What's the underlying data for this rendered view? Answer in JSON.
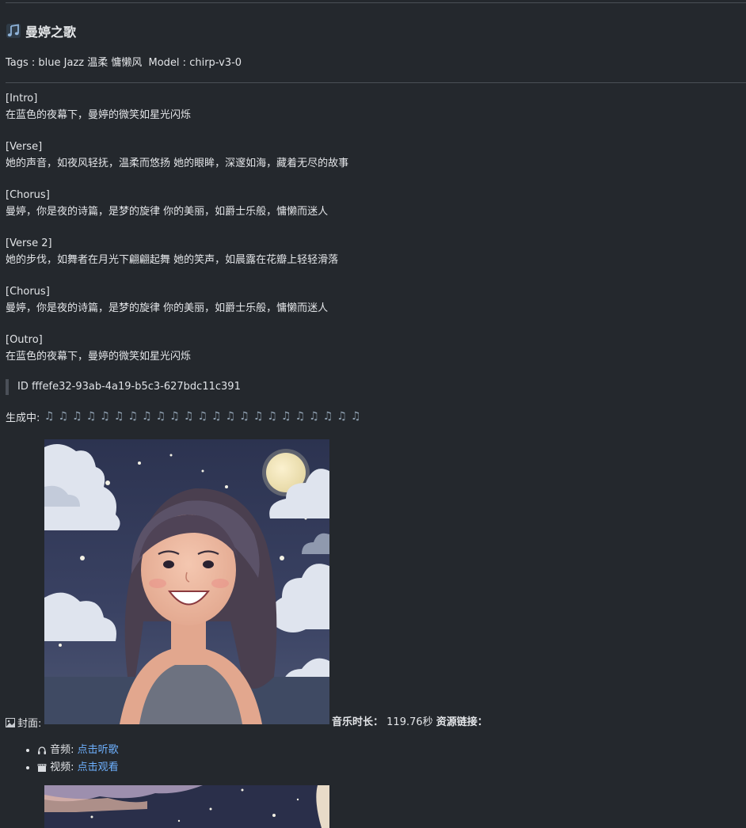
{
  "page": {
    "title": "曼婷之歌",
    "title_icon": "music-note-icon",
    "tags_line": {
      "tags_label": "Tags : blue Jazz 温柔 慵懒风",
      "model_label": "Model : chirp-v3-0"
    }
  },
  "lyrics": [
    {
      "label": "[Intro]",
      "text": "在蓝色的夜幕下，曼婷的微笑如星光闪烁"
    },
    {
      "label": "[Verse]",
      "text": "她的声音，如夜风轻抚，温柔而悠扬 她的眼眸，深邃如海，藏着无尽的故事"
    },
    {
      "label": "[Chorus]",
      "text": "曼婷，你是夜的诗篇，是梦的旋律 你的美丽，如爵士乐般，慵懒而迷人"
    },
    {
      "label": "[Verse 2]",
      "text": "她的步伐，如舞者在月光下翩翩起舞 她的笑声，如晨露在花瓣上轻轻滑落"
    },
    {
      "label": "[Chorus]",
      "text": "曼婷，你是夜的诗篇，是梦的旋律 你的美丽，如爵士乐般，慵懒而迷人"
    },
    {
      "label": "[Outro]",
      "text": "在蓝色的夜幕下，曼婷的微笑如星光闪烁"
    }
  ],
  "id_quote": "ID fffefe32-93ab-4a19-b5c3-627bdc11c391",
  "progress": {
    "label": "生成中:",
    "note_icon": "music-note-icon",
    "note_count": 23
  },
  "cover": {
    "prefix_icon": "image-icon",
    "label": "封面:",
    "duration_label": "音乐时长：",
    "duration_value": "119.76秒",
    "resources_label": "资源链接："
  },
  "resources": [
    {
      "icon": "headphones-icon",
      "label": "音频:",
      "link": "点击听歌"
    },
    {
      "icon": "clapper-icon",
      "label": "视频:",
      "link": "点击观看"
    }
  ],
  "colors": {
    "background": "#24282d",
    "text": "#e3e5e8",
    "link": "#6eb1ff",
    "rule": "#4a4f56"
  }
}
